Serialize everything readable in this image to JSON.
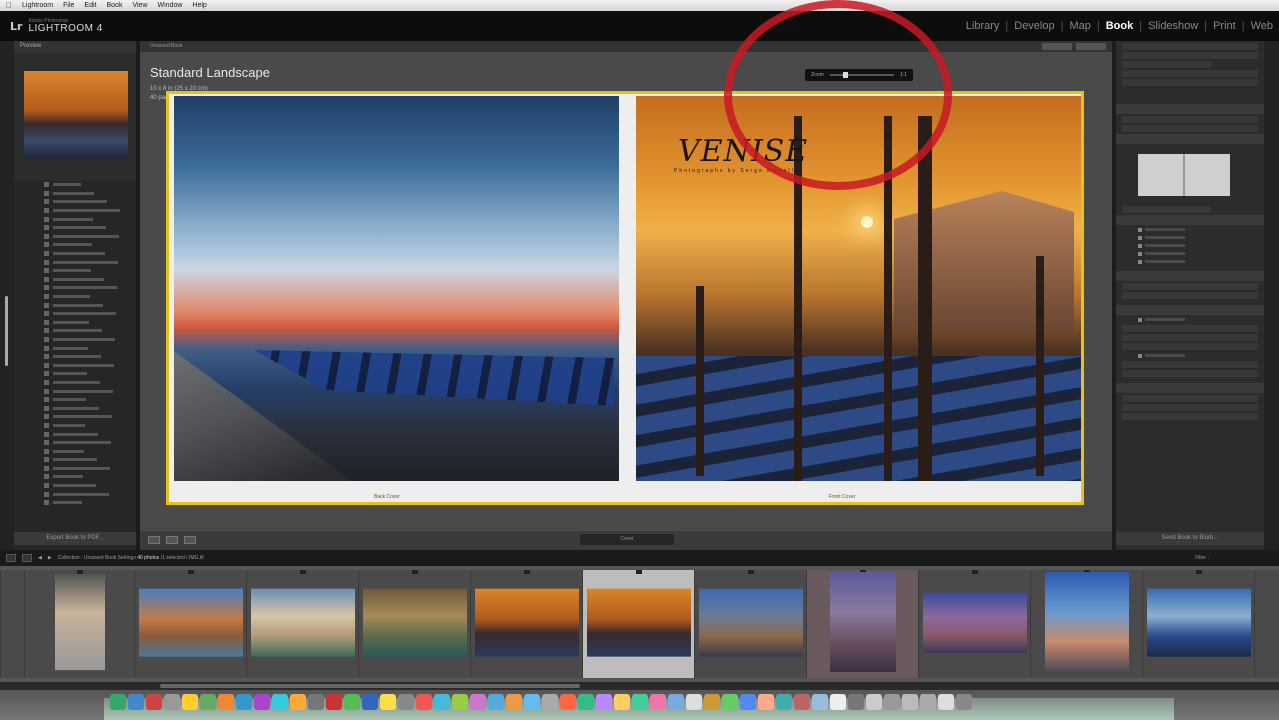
{
  "menubar": {
    "apple": "",
    "items": [
      "Lightroom",
      "File",
      "Edit",
      "Book",
      "View",
      "Window",
      "Help"
    ]
  },
  "app": {
    "logo_mark": "Lr",
    "logo_small": "Adobe Photoshop",
    "title": "LIGHTROOM 4"
  },
  "modules": [
    "Library",
    "Develop",
    "Map",
    "Book",
    "Slideshow",
    "Print",
    "Web"
  ],
  "active_module": "Book",
  "left_panel": {
    "header": "Preview",
    "export_button": "Export Book to PDF..."
  },
  "center": {
    "header": "Unsaved Book",
    "book_title": "Standard Landscape",
    "book_line1": "10 x 8 in (25 x 20 cm)",
    "book_line2": "40 pages - €40.77",
    "logo_text": "VENISE",
    "logo_subtext": "Photographs by Serge Ramelli",
    "back_cover_label": "Back Cover",
    "front_cover_label": "Front Cover",
    "zoom_left": "Zoom",
    "zoom_right": "1:1",
    "pager": "Cover"
  },
  "right_panel": {
    "send_button": "Send Book to Blurb..."
  },
  "filmstrip_toolbar": {
    "source": "Collection : Unsaved Book Settings",
    "count": "40 photos",
    "detail": "/1 selected / IMG.tif",
    "filter_label": "Filter :"
  },
  "colors": {
    "accent_highlight": "#e4c31a",
    "annotation_ring": "#c81923"
  },
  "dock_colors": [
    "#3a6",
    "#48c",
    "#c44",
    "#999",
    "#fc3",
    "#6a6",
    "#e83",
    "#39c",
    "#a4c",
    "#3cd",
    "#fa3",
    "#777",
    "#c33",
    "#5b5",
    "#36b",
    "#fd4",
    "#888",
    "#e55",
    "#4bd",
    "#9c4",
    "#c7c",
    "#5ad",
    "#e94",
    "#6be",
    "#aaa",
    "#f64",
    "#3b8",
    "#b8f",
    "#fc6",
    "#4c9",
    "#e7a",
    "#7ad",
    "#ddd",
    "#c93",
    "#6c6",
    "#58e",
    "#fa8",
    "#4aa",
    "#b66",
    "#9bd",
    "#eee",
    "#777",
    "#ccc",
    "#999",
    "#bbb",
    "#aaa",
    "#ddd",
    "#888"
  ]
}
